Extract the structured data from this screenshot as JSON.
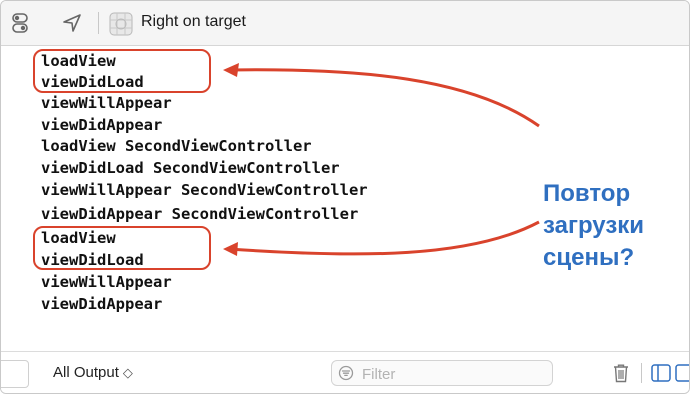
{
  "toolbar": {
    "title": "Right on target",
    "icons": [
      "toggle-icon",
      "location-arrow-icon",
      "app-icon"
    ]
  },
  "console": {
    "lines": [
      "loadView",
      "viewDidLoad",
      "viewWillAppear",
      "viewDidAppear",
      "loadView SecondViewController",
      "viewDidLoad SecondViewController",
      "viewWillAppear SecondViewController",
      "viewDidAppear SecondViewController",
      "loadView",
      "viewDidLoad",
      "viewWillAppear",
      "viewDidAppear"
    ]
  },
  "annotation": {
    "line1": "Повтор",
    "line2": "загрузки",
    "line3": "сцены?"
  },
  "footer": {
    "output_label": "All Output",
    "output_chevron": "◇",
    "filter_placeholder": "Filter",
    "icons": [
      "trash-icon",
      "left-panel-icon",
      "right-panel-icon"
    ]
  },
  "colors": {
    "highlight": "#d9432c",
    "annotation": "#2f6fc0"
  }
}
